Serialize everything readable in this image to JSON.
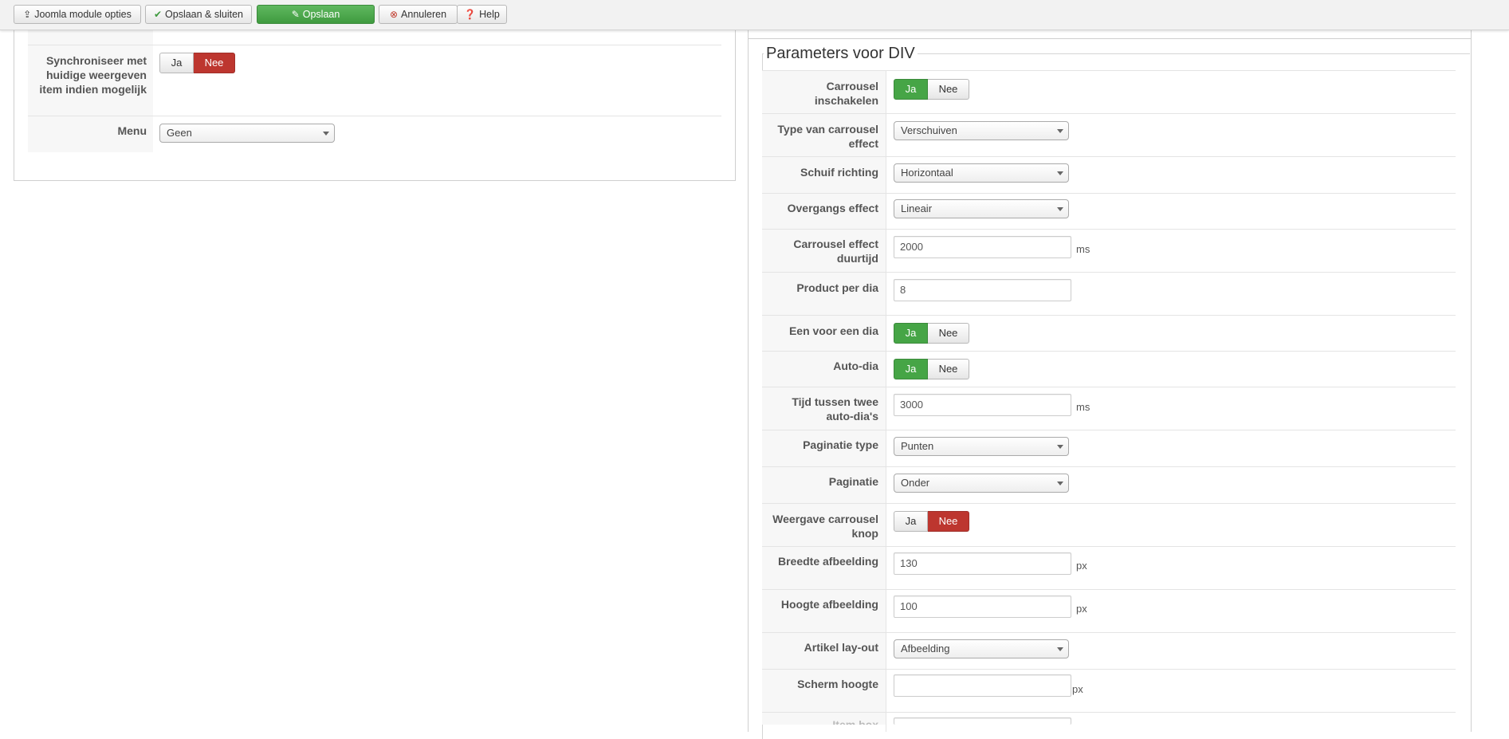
{
  "toolbar": {
    "module_options": "Joomla module opties",
    "save_close": "Opslaan & sluiten",
    "save": "Opslaan",
    "cancel": "Annuleren",
    "help": "Help"
  },
  "left": {
    "sync_label": "Synchroniseer met huidige weergeven item indien mogelijk",
    "sync_yes": "Ja",
    "sync_no": "Nee",
    "sync_value": "Nee",
    "menu_label": "Menu",
    "menu_value": "Geen"
  },
  "right": {
    "legend": "Parameters voor DIV",
    "carousel_enable_label": "Carrousel inschakelen",
    "carousel_enable_value": "Ja",
    "effect_type_label": "Type van carrousel effect",
    "effect_type_value": "Verschuiven",
    "direction_label": "Schuif richting",
    "direction_value": "Horizontaal",
    "transition_label": "Overgangs effect",
    "transition_value": "Lineair",
    "duration_label": "Carrousel effect duurtijd",
    "duration_value": "2000",
    "duration_unit": "ms",
    "per_slide_label": "Product per dia",
    "per_slide_value": "8",
    "one_by_one_label": "Een voor een dia",
    "one_by_one_value": "Ja",
    "auto_label": "Auto-dia",
    "auto_value": "Ja",
    "interval_label": "Tijd tussen twee auto-dia's",
    "interval_value": "3000",
    "interval_unit": "ms",
    "pagination_type_label": "Paginatie type",
    "pagination_type_value": "Punten",
    "pagination_label": "Paginatie",
    "pagination_value": "Onder",
    "show_buttons_label": "Weergave carrousel knop",
    "show_buttons_value": "Nee",
    "img_width_label": "Breedte afbeelding",
    "img_width_value": "130",
    "img_width_unit": "px",
    "img_height_label": "Hoogte afbeelding",
    "img_height_value": "100",
    "img_height_unit": "px",
    "layout_label": "Artikel lay-out",
    "layout_value": "Afbeelding",
    "screen_height_label": "Scherm hoogte",
    "screen_height_value": "",
    "screen_height_unit": "px",
    "next_label_partial": "Item box",
    "yes": "Ja",
    "no": "Nee"
  },
  "colors": {
    "active_green": "#46a546",
    "active_red": "#bd362f"
  }
}
